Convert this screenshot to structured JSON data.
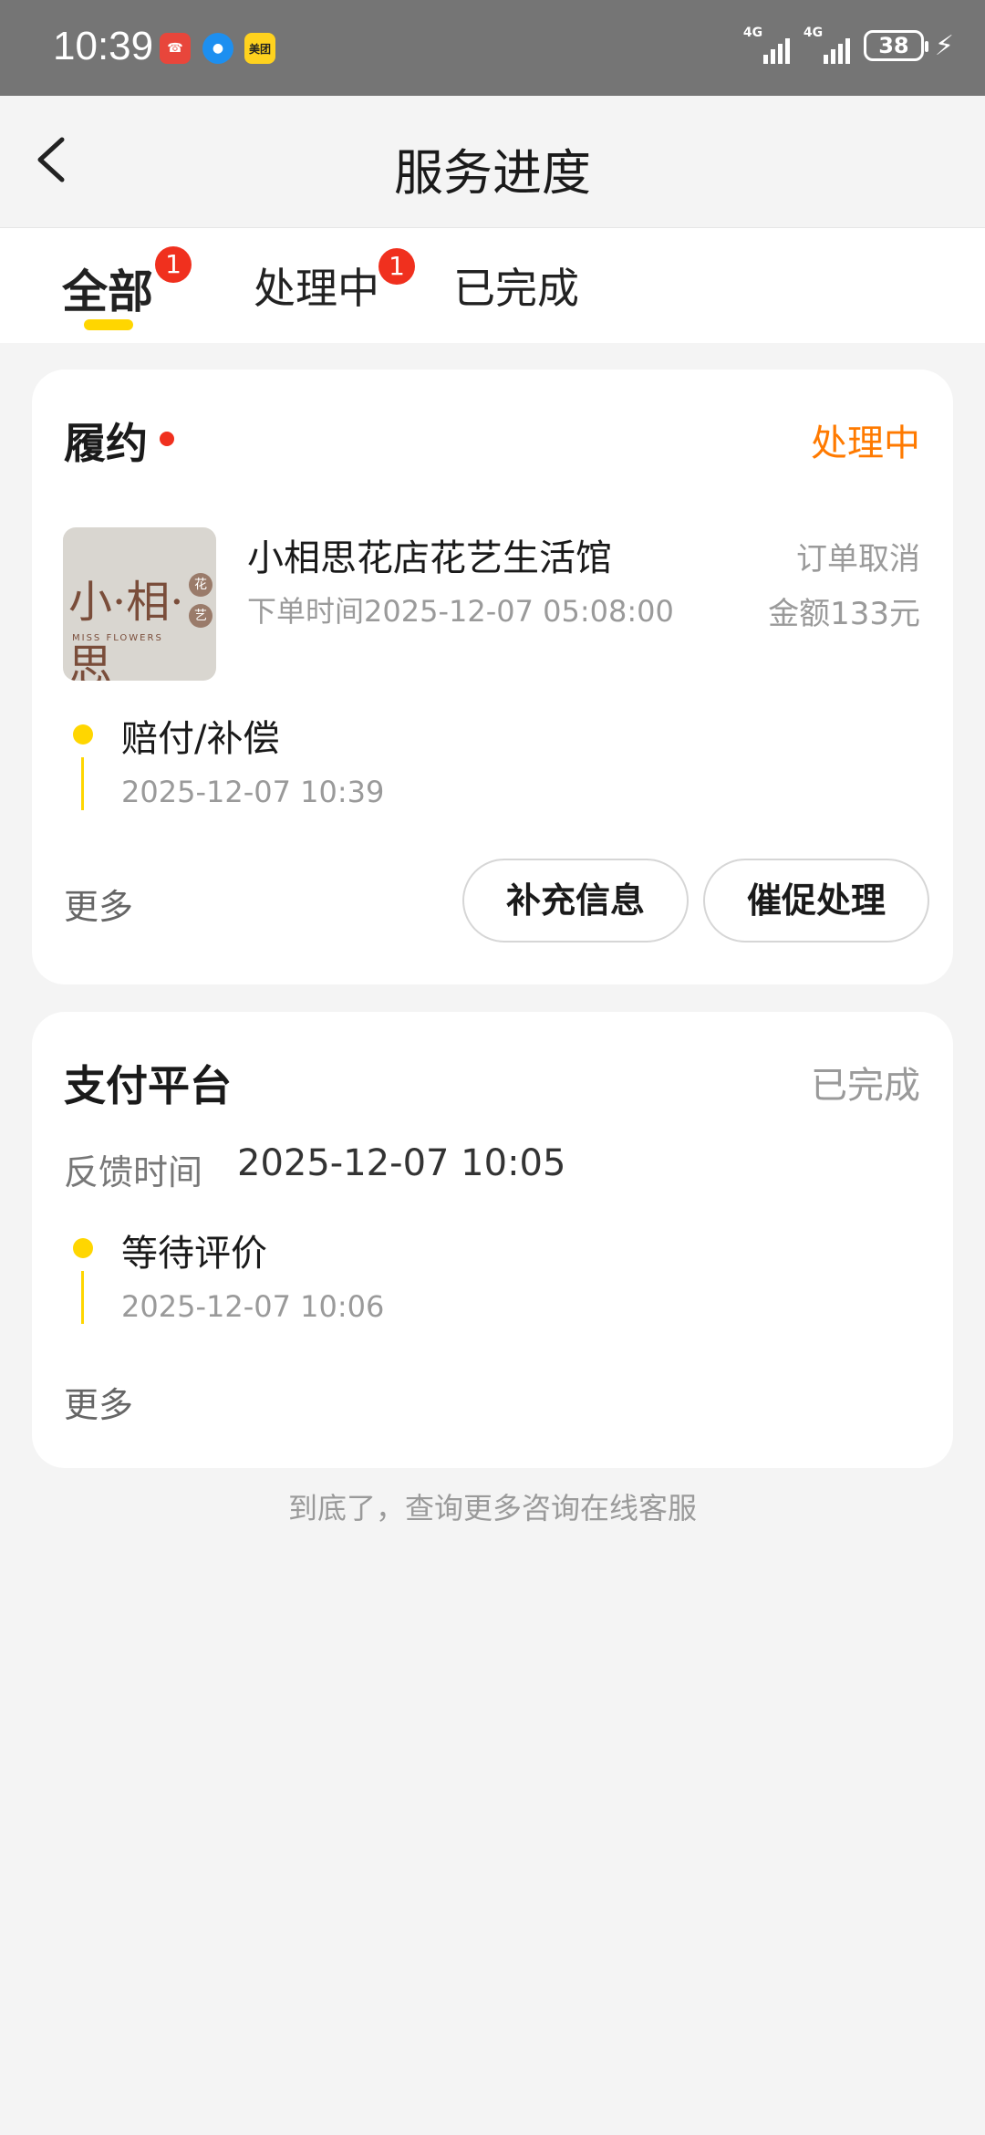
{
  "status_bar": {
    "time": "10:39",
    "apps": [
      "missed-call-icon",
      "message-icon",
      "美团"
    ],
    "signal1_label": "4G",
    "signal2_label": "4G",
    "battery": "38",
    "charging": true
  },
  "header": {
    "title": "服务进度"
  },
  "tabs": [
    {
      "label": "全部",
      "badge": "1",
      "active": true
    },
    {
      "label": "处理中",
      "badge": "1",
      "active": false
    },
    {
      "label": "已完成",
      "badge": "",
      "active": false
    }
  ],
  "card1": {
    "title": "履约",
    "status": "处理中",
    "status_color": "#ff7a00",
    "shop_name": "小相思花店花艺生活馆",
    "order_time": "下单时间2025-12-07 05:08:00",
    "order_state": "订单取消",
    "amount": "金额133元",
    "thumb": {
      "logo": "小·相·思",
      "sub": "MISS FLOWERS",
      "seal1": "花",
      "seal2": "艺"
    },
    "timeline": {
      "title": "赔付/补偿",
      "time": "2025-12-07 10:39"
    },
    "more": "更多",
    "btn_supplement": "补充信息",
    "btn_urge": "催促处理"
  },
  "card2": {
    "title": "支付平台",
    "status": "已完成",
    "status_color": "#9a9a9a",
    "feedback_label": "反馈时间",
    "feedback_time": "2025-12-07 10:05",
    "timeline": {
      "title": "等待评价",
      "time": "2025-12-07 10:06"
    },
    "more": "更多"
  },
  "footer_note": "到底了，查询更多咨询在线客服"
}
